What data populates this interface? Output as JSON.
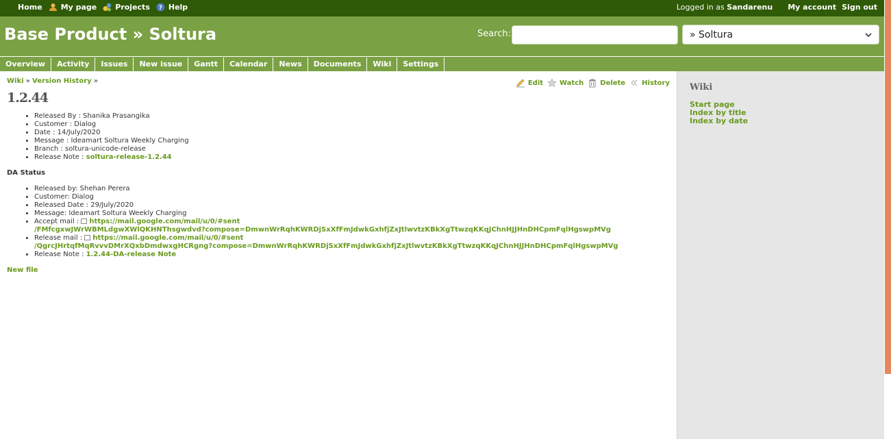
{
  "top_menu": {
    "items": [
      {
        "label": "Home",
        "icon": ""
      },
      {
        "label": "My page",
        "icon": "user-icon"
      },
      {
        "label": "Projects",
        "icon": "projects-icon"
      },
      {
        "label": "Help",
        "icon": "help-icon"
      }
    ],
    "logged_in_prefix": "Logged in as",
    "user": "Sandarenu",
    "my_account": "My account",
    "sign_out": "Sign out"
  },
  "header": {
    "title": "Base Product » Soltura",
    "search_label": "Search:",
    "search_value": "",
    "project_select": "» Soltura"
  },
  "main_menu": [
    "Overview",
    "Activity",
    "Issues",
    "New issue",
    "Gantt",
    "Calendar",
    "News",
    "Documents",
    "Wiki",
    "Settings"
  ],
  "breadcrumb": {
    "wiki": "Wiki",
    "sep1": "»",
    "version_history": "Version History",
    "sep2": "»"
  },
  "contextual": {
    "edit": "Edit",
    "watch": "Watch",
    "delete": "Delete",
    "history": "History"
  },
  "page": {
    "title": "1.2.44",
    "release_info": [
      {
        "text": "Released By : Shanika Prasangika"
      },
      {
        "text": "Customer : Dialog"
      },
      {
        "text": "Date : 14/July/2020"
      },
      {
        "text": "Message : Ideamart Soltura Weekly Charging"
      },
      {
        "text": "Branch : soltura-unicode-release"
      }
    ],
    "release_note_label": "Release Note :",
    "release_note_link": "soltura-release-1.2.44",
    "da_status_title": "DA Status",
    "da_info": [
      {
        "text": "Released by: Shehan Perera"
      },
      {
        "text": "Customer: Dialog"
      },
      {
        "text": "Released Date : 29/July/2020"
      },
      {
        "text": "Message: Ideamart Soltura Weekly Charging"
      }
    ],
    "accept_mail_label": "Accept mail :",
    "accept_mail_link_1": "https://mail.google.com/mail/u/0/#sent",
    "accept_mail_link_2": "/FMfcgxwJWrWBMLdgwXWlQKHNThsgwdvd?compose=DmwnWrRqhKWRDjSxXfFmJdwkGxhfjZxJtlwvtzKBkXgTtwzqKKqJChnHJJHnDHCpmFqlHgswpMVg",
    "release_mail_label": "Release mail :",
    "release_mail_link_1": "https://mail.google.com/mail/u/0/#sent",
    "release_mail_link_2": "/QgrcJHrtqfMqRvvvDMrXQxbDmdwxgHCRgng?compose=DmwnWrRqhKWRDjSxXfFmJdwkGxhfjZxJtlwvtzKBkXgTtwzqKKqJChnHJJHnDHCpmFqlHgswpMVg",
    "da_release_note_label": "Release Note :",
    "da_release_note_link": "1.2.44-DA-release Note",
    "new_file": "New file"
  },
  "sidebar": {
    "title": "Wiki",
    "links": [
      "Start page",
      "Index by title",
      "Index by date"
    ]
  },
  "colors": {
    "top_bar": "#2f5a07",
    "header": "#7aa144",
    "link": "#6a9a1f",
    "sidebar": "#e6e6e6",
    "scrollbar": "#e5875e"
  }
}
